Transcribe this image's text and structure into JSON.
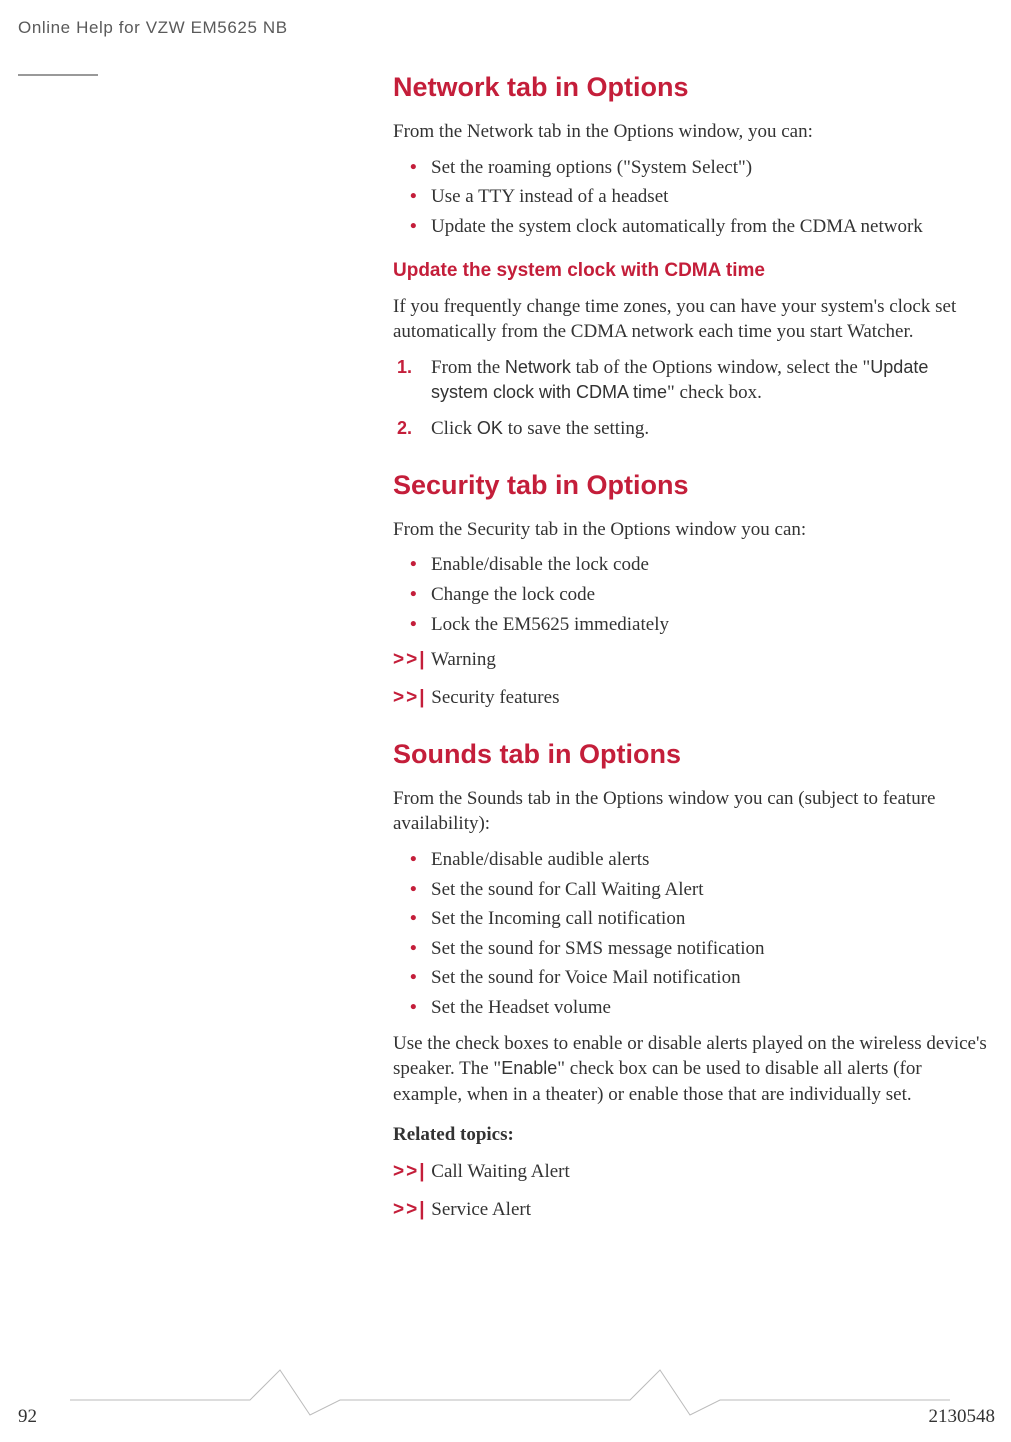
{
  "header": {
    "title": "Online Help for VZW EM5625 NB"
  },
  "footer": {
    "pageNumber": "92",
    "docNumber": "2130548"
  },
  "network": {
    "heading": "Network tab in Options",
    "intro": "From the Network tab in the Options window, you can:",
    "bullets": [
      "Set the roaming options (\"System Select\")",
      "Use a TTY instead of a headset",
      "Update the system clock automatically from the CDMA network"
    ],
    "sub": {
      "heading": "Update the system clock with CDMA time",
      "para": "If you frequently change time zones, you can have your system's clock set automatically from the CDMA network each time you start Watcher.",
      "steps": [
        {
          "num": "1.",
          "pre": "From the ",
          "term1": "Network",
          "mid": " tab of the Options window, select the \"",
          "term2": "Update system clock with CDMA time",
          "post": "\" check box."
        },
        {
          "num": "2.",
          "pre": "Click ",
          "term1": "OK",
          "mid": " to save the setting.",
          "term2": "",
          "post": ""
        }
      ]
    }
  },
  "security": {
    "heading": "Security tab in Options",
    "intro": "From the Security tab in the Options window you can:",
    "bullets": [
      "Enable/disable the lock code",
      "Change the lock code",
      "Lock the EM5625 immediately"
    ],
    "links": [
      "Warning",
      "Security features"
    ]
  },
  "sounds": {
    "heading": "Sounds tab in Options",
    "intro": "From the Sounds tab in the Options window you can (subject to feature availability):",
    "bullets": [
      "Enable/disable audible alerts",
      "Set the sound for Call Waiting Alert",
      "Set the Incoming call notification",
      "Set the sound for SMS message notification",
      "Set the sound for Voice Mail notification",
      "Set the Headset volume"
    ],
    "paraPre": "Use the check boxes to enable or disable alerts played on the wireless device's speaker. The \"",
    "paraTerm": "Enable",
    "paraPost": "\" check box can be used to disable all alerts (for example, when in a theater) or enable those that are individually set.",
    "relatedLabel": "Related topics:",
    "links": [
      "Call Waiting Alert",
      "Service Alert"
    ]
  },
  "linkMarker": ">>|"
}
